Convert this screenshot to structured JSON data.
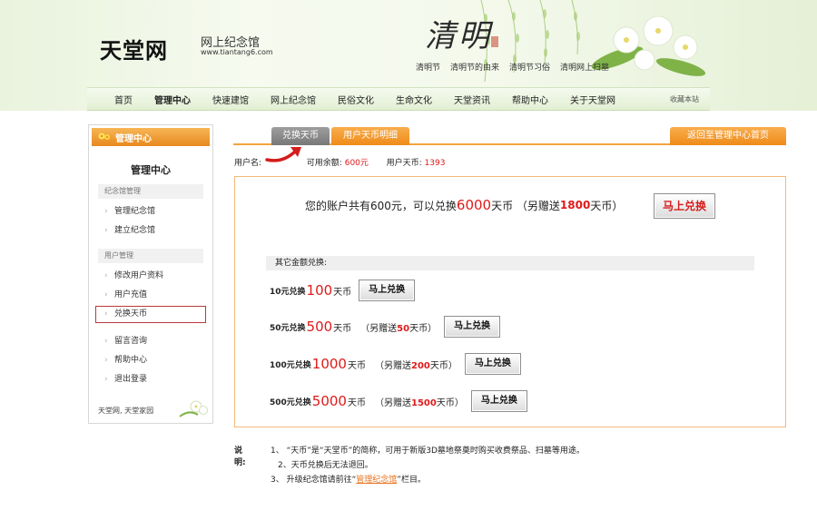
{
  "header": {
    "logo": "天堂网",
    "subtitle": "网上纪念馆",
    "url": "www.tiantang6.com",
    "art_title": "清明",
    "festival_links": [
      "清明节",
      "清明节的由来",
      "清明节习俗",
      "清明网上扫墓"
    ]
  },
  "nav": {
    "items": [
      "首页",
      "管理中心",
      "快速建馆",
      "网上纪念馆",
      "民俗文化",
      "生命文化",
      "天堂资讯",
      "帮助中心",
      "关于天堂网"
    ],
    "favorite": "收藏本站"
  },
  "sidebar": {
    "header": "管理中心",
    "title": "管理中心",
    "group1": "纪念馆管理",
    "group1_items": [
      "管理纪念馆",
      "建立纪念馆"
    ],
    "group2": "用户管理",
    "group2_items": [
      "修改用户资料",
      "用户充值",
      "兑换天币"
    ],
    "group3_items": [
      "留言咨询",
      "帮助中心",
      "退出登录"
    ],
    "footer": "天堂网, 天堂家园"
  },
  "tabs": {
    "exchange": "兑换天币",
    "detail": "用户天币明细",
    "back": "返回至管理中心首页"
  },
  "userinfo": {
    "username_label": "用户名:",
    "balance_label": "可用余额:",
    "balance_value": "600元",
    "coins_label": "用户天币:",
    "coins_value": "1393"
  },
  "main_offer": {
    "text1": "您的账户共有600元，可以兑换",
    "coins": "6000",
    "text2": "天币 （另赠送",
    "bonus": "1800",
    "text3": "天币）",
    "button": "马上兑换"
  },
  "other": {
    "title": "其它金额兑换:",
    "options": [
      {
        "amount": "10元兑换",
        "coins": "100",
        "unit": "天币",
        "note_pre": "",
        "bonus": "",
        "note_post": "",
        "button": "马上兑换"
      },
      {
        "amount": "50元兑换",
        "coins": "500",
        "unit": "天币",
        "note_pre": "（另赠送",
        "bonus": "50",
        "note_post": "天币）",
        "button": "马上兑换"
      },
      {
        "amount": "100元兑换",
        "coins": "1000",
        "unit": "天币",
        "note_pre": "（另赠送",
        "bonus": "200",
        "note_post": "天币）",
        "button": "马上兑换"
      },
      {
        "amount": "500元兑换",
        "coins": "5000",
        "unit": "天币",
        "note_pre": "（另赠送",
        "bonus": "1500",
        "note_post": "天币）",
        "button": "马上兑换"
      }
    ]
  },
  "notes": {
    "head": "说明:",
    "line1": "1、 “天币”是“天堂币”的简称，可用于新版3D墓地祭奠时购买收费祭品、扫墓等用途。",
    "line2": "2、天币兑换后无法退回。",
    "line3_pre": "3、 升级纪念馆请前往“",
    "line3_link": "管理纪念馆",
    "line3_post": "”栏目。"
  }
}
